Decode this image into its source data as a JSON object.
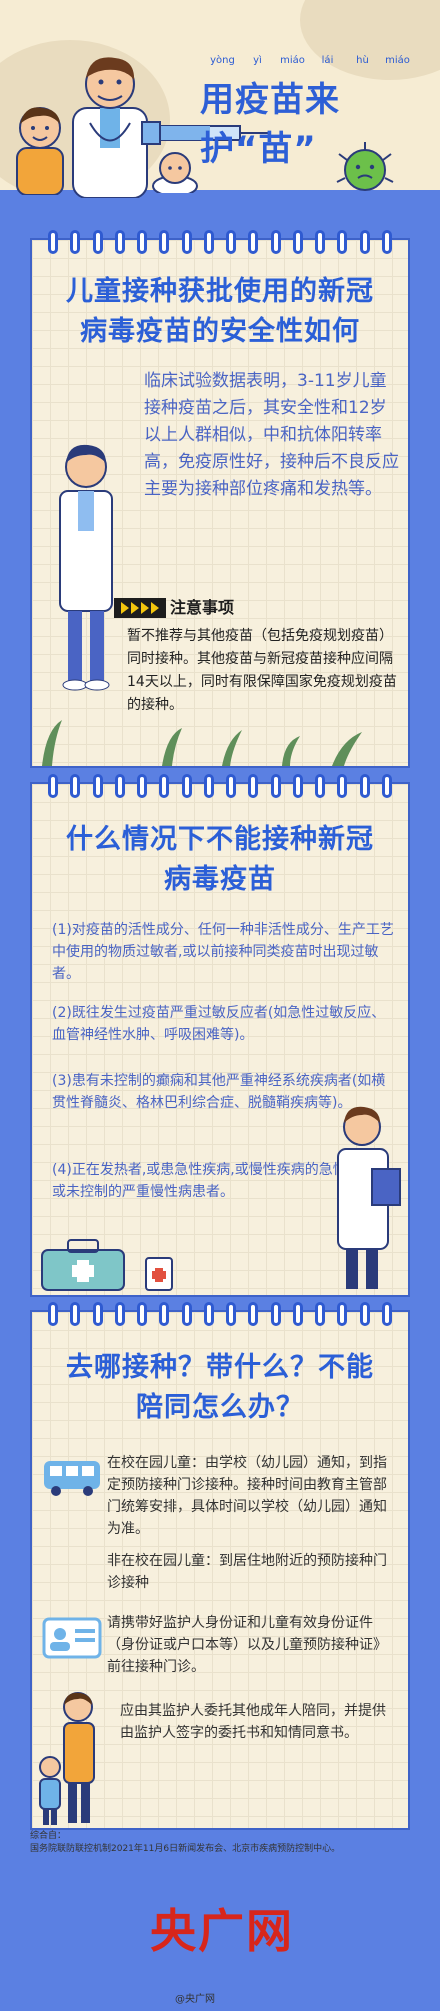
{
  "header": {
    "pinyin": [
      "yòng",
      "yì",
      "miáo",
      "lái",
      "hù",
      "miáo"
    ],
    "title": "用疫苗来护“苗”"
  },
  "section1": {
    "heading_line1": "儿童接种获批使用的新冠",
    "heading_line2": "病毒疫苗的安全性如何",
    "body": "临床试验数据表明，3-11岁儿童接种疫苗之后，其安全性和12岁以上人群相似，中和抗体阳转率高，免疫原性好，接种后不良反应主要为接种部位疼痛和发热等。",
    "notice_title": "注意事项",
    "notice_text": "暂不推荐与其他疫苗（包括免疫规划疫苗）同时接种。其他疫苗与新冠疫苗接种应间隔14天以上，同时有限保障国家免疫规划疫苗的接种。"
  },
  "section2": {
    "heading_line1": "什么情况下不能接种新冠",
    "heading_line2": "病毒疫苗",
    "items": [
      "(1)对疫苗的活性成分、任何一种非活性成分、生产工艺中使用的物质过敏者,或以前接种同类疫苗时出现过敏者。",
      "(2)既往发生过疫苗严重过敏反应者(如急性过敏反应、血管神经性水肿、呼吸困难等)。",
      "(3)患有未控制的癫痫和其他严重神经系统疾病者(如横贯性脊髓炎、格林巴利综合症、脱髓鞘疾病等)。",
      "(4)正在发热者,或患急性疾病,或慢性疾病的急性发作期,或未控制的严重慢性病患者。"
    ]
  },
  "section3": {
    "heading_line1": "去哪接种？带什么？不能",
    "heading_line2": "陪同怎么办？",
    "in_school": "在校在园儿童：由学校（幼儿园）通知，到指定预防接种门诊接种。接种时间由教育主管部门统筹安排，具体时间以学校（幼儿园）通知为准。",
    "not_in_school": "非在校在园儿童：到居住地附近的预防接种门诊接种",
    "documents": "请携带好监护人身份证和儿童有效身份证件（身份证或户口本等）以及儿童预防接种证》前往接种门诊。",
    "entrust": "应由其监护人委托其他成年人陪同，并提供由监护人签字的委托书和知情同意书。"
  },
  "footer": {
    "source_label": "综合自：",
    "source_text": "国务院联防联控机制2021年11月6日新闻发布会、北京市疾病预防控制中心。",
    "logo": "央广网",
    "watermark": "@央广网"
  },
  "colors": {
    "background": "#5b80e2",
    "panel": "#f7f0dd",
    "heading": "#2b5fd7",
    "body_text": "#4a64c4",
    "logo": "#d7261b"
  }
}
